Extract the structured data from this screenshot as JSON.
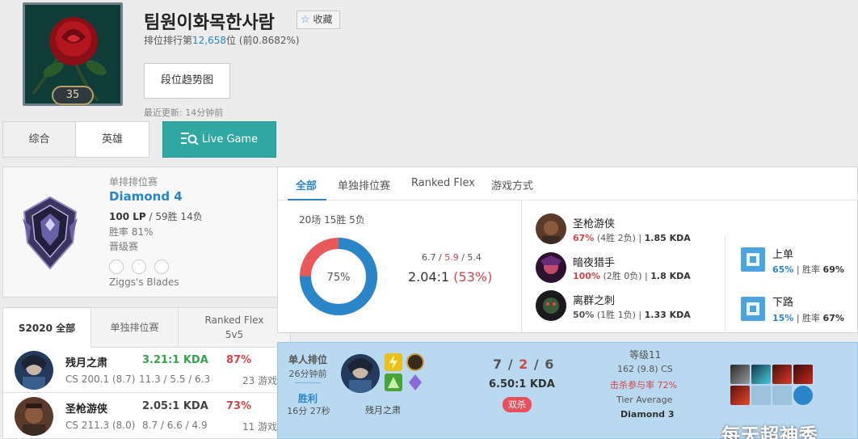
{
  "profile": {
    "name": "팀원이화목한사람",
    "favorite_label": "收藏",
    "rank_prefix": "排位排行第",
    "rank_number": "12,658",
    "rank_suffix": "位 (前0.8682%)",
    "level": "35",
    "tier_graph_button": "段位趋势图",
    "updated": "最近更新: 14分钟前"
  },
  "tabs": {
    "overview": "综合",
    "champions": "英雄",
    "live": "Live Game"
  },
  "ranked_solo": {
    "label": "单排排位赛",
    "tier": "Diamond 4",
    "lp": "100 LP",
    "record": " / 59胜 14负",
    "winrate": "胜率 81%",
    "promo": "晋级赛",
    "team": "Ziggs's Blades"
  },
  "season_tabs": {
    "all": "S2020 全部",
    "solo": "单独排位赛",
    "flex": "Ranked Flex",
    "flex_sub": "5v5"
  },
  "season_champions": [
    {
      "name": "残月之肃",
      "kda": "3.21:1 KDA",
      "winrate": "87%",
      "cs": "CS 200.1 (8.7)",
      "kda_detail": "11.3 / 5.5 / 6.3",
      "games": "23 游戏"
    },
    {
      "name": "圣枪游侠",
      "kda": "2.05:1 KDA",
      "winrate": "73%",
      "cs": "CS 211.3 (8.0)",
      "kda_detail": "8.7 / 6.6 / 4.9",
      "games": "11 游戏"
    }
  ],
  "filter_tabs": {
    "all": "全部",
    "solo": "单独排位赛",
    "flex": "Ranked Flex",
    "mode": "游戏方式"
  },
  "summary": {
    "games": "20场 15胜 5负",
    "winrate_label": "75%",
    "win_fraction": 0.75,
    "kills": "6.7",
    "deaths": "5.9",
    "assists": "5.4",
    "ratio": "2.04:1",
    "ratio_pct": "(53%)"
  },
  "recent_champions": [
    {
      "name": "圣枪游侠",
      "wr": "67%",
      "record": " (4胜 2负)",
      "kda": "1.85 KDA"
    },
    {
      "name": "暗夜猎手",
      "wr": "100%",
      "record": " (2胜 0负)",
      "kda": "1.8 KDA"
    },
    {
      "name": "离群之刺",
      "wr": "50%",
      "record": " (1胜 1负)",
      "kda": "1.33 KDA"
    }
  ],
  "positions": [
    {
      "name": "上单",
      "pct": "65%",
      "wr_label": "胜率 ",
      "wr": "69%"
    },
    {
      "name": "下路",
      "pct": "15%",
      "wr_label": "胜率 ",
      "wr": "67%"
    }
  ],
  "match": {
    "type": "单人排位",
    "ago": "26分钟前",
    "result": "胜利",
    "duration": "16分 27秒",
    "champion": "残月之肃",
    "k": "7",
    "d": "2",
    "a": "6",
    "ratio": "6.50:1 KDA",
    "badge": "双杀",
    "level": "等级11",
    "cs": "162 (9.8) CS",
    "kp": "击杀参与率 72%",
    "tier_avg_label": "Tier Average",
    "tier_avg": "Diamond 3"
  },
  "watermark": "每天超神秀",
  "colors": {
    "accent_blue": "#2a86c8",
    "loss_red": "#d0474b",
    "live_teal": "#31a9a3",
    "win_row": "#b9d9f0"
  }
}
